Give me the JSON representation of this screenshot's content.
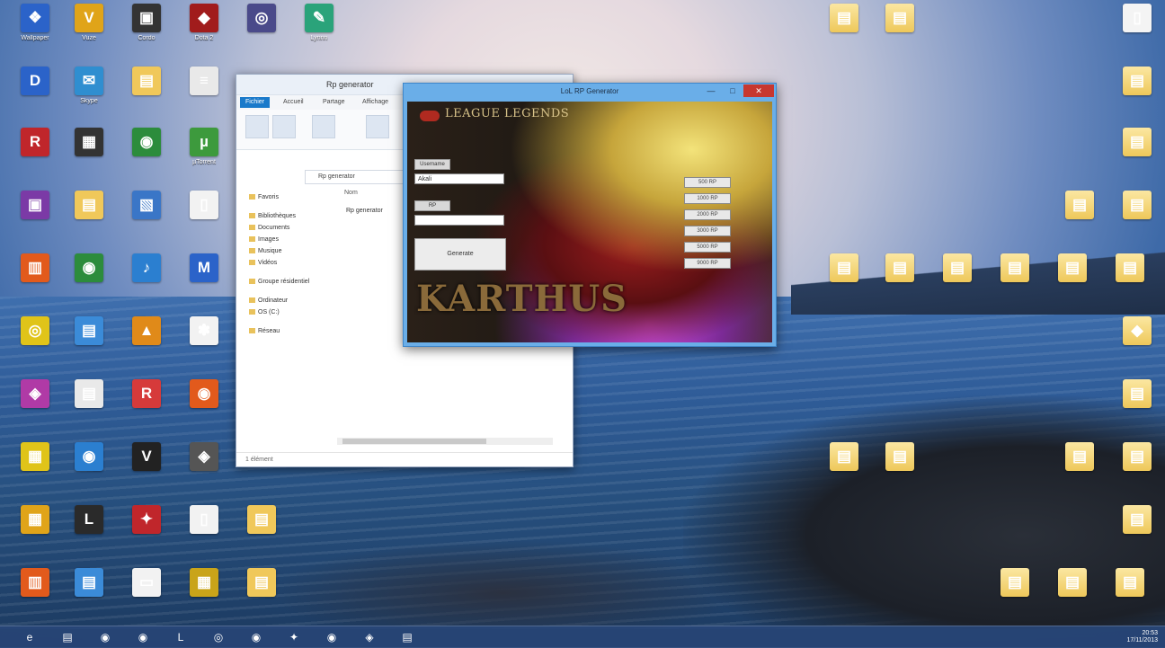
{
  "desktop": {
    "icons_left": [
      {
        "label": "Wallpaper",
        "glyph": "❖",
        "color": "#2b63c9"
      },
      {
        "label": "Vuze",
        "glyph": "V",
        "color": "#e0a419"
      },
      {
        "label": "Cordo",
        "glyph": "▣",
        "color": "#333333"
      },
      {
        "label": "Dota 2",
        "glyph": "◆",
        "color": "#a11c1c"
      },
      {
        "label": "",
        "glyph": "◎",
        "color": "#4a4a8a"
      },
      {
        "label": "Lynnn",
        "glyph": "✎",
        "color": "#2aa37a"
      },
      {
        "label": "",
        "glyph": "D",
        "color": "#2b63c9"
      },
      {
        "label": "Skype",
        "glyph": "✉",
        "color": "#2f8ed0"
      },
      {
        "label": "",
        "glyph": "▤",
        "color": "#f0c85a"
      },
      {
        "label": "",
        "glyph": "≡",
        "color": "#e9e9e9"
      },
      {
        "label": "",
        "glyph": "R",
        "color": "#c0262b"
      },
      {
        "label": "",
        "glyph": "▦",
        "color": "#333333"
      },
      {
        "label": "",
        "glyph": "◉",
        "color": "#2c8c3c"
      },
      {
        "label": "µTorrent",
        "glyph": "µ",
        "color": "#3d9a3d"
      },
      {
        "label": "",
        "glyph": "▣",
        "color": "#7b3aa6"
      },
      {
        "label": "",
        "glyph": "▤",
        "color": "#f0c85a"
      },
      {
        "label": "",
        "glyph": "▧",
        "color": "#3a76c7"
      },
      {
        "label": "",
        "glyph": "▯",
        "color": "#f2f2f2"
      },
      {
        "label": "",
        "glyph": "▥",
        "color": "#e25a1c"
      },
      {
        "label": "",
        "glyph": "◉",
        "color": "#2c8c3c"
      },
      {
        "label": "",
        "glyph": "♪",
        "color": "#2b7fd0"
      },
      {
        "label": "",
        "glyph": "M",
        "color": "#2b63c9"
      },
      {
        "label": "",
        "glyph": "◎",
        "color": "#e0c419"
      },
      {
        "label": "",
        "glyph": "▤",
        "color": "#3b8bd8"
      },
      {
        "label": "",
        "glyph": "▲",
        "color": "#e08a19"
      },
      {
        "label": "",
        "glyph": "✽",
        "color": "#f2f2f2"
      },
      {
        "label": "",
        "glyph": "◈",
        "color": "#b03aa6"
      },
      {
        "label": "",
        "glyph": "▤",
        "color": "#e9e9e9"
      },
      {
        "label": "",
        "glyph": "R",
        "color": "#d63a3a"
      },
      {
        "label": "",
        "glyph": "◉",
        "color": "#e25a1c"
      },
      {
        "label": "",
        "glyph": "▦",
        "color": "#e0c419"
      },
      {
        "label": "",
        "glyph": "◉",
        "color": "#2b7fd0"
      },
      {
        "label": "",
        "glyph": "V",
        "color": "#222222"
      },
      {
        "label": "",
        "glyph": "◈",
        "color": "#555555"
      },
      {
        "label": "",
        "glyph": "▦",
        "color": "#e0a419"
      },
      {
        "label": "",
        "glyph": "L",
        "color": "#2a2a2a"
      },
      {
        "label": "",
        "glyph": "✦",
        "color": "#c0262b"
      },
      {
        "label": "",
        "glyph": "▯",
        "color": "#f2f2f2"
      },
      {
        "label": "",
        "glyph": "▤",
        "color": "#f0c85a"
      },
      {
        "label": "",
        "glyph": "▥",
        "color": "#e25a1c"
      },
      {
        "label": "",
        "glyph": "▤",
        "color": "#3b8bd8"
      },
      {
        "label": "",
        "glyph": "▭",
        "color": "#f2f2f2"
      },
      {
        "label": "",
        "glyph": "▦",
        "color": "#c9a419"
      },
      {
        "label": "",
        "glyph": "▤",
        "color": "#f0c85a"
      }
    ],
    "icons_right": [
      {
        "label": "",
        "glyph": "▤"
      },
      {
        "label": "",
        "glyph": "▤"
      },
      {
        "label": "",
        "glyph": "▯"
      },
      {
        "label": "",
        "glyph": "▤"
      },
      {
        "label": "",
        "glyph": "▤"
      },
      {
        "label": "",
        "glyph": "▤"
      },
      {
        "label": "",
        "glyph": "▤"
      },
      {
        "label": "",
        "glyph": "▤"
      },
      {
        "label": "",
        "glyph": "▤"
      },
      {
        "label": "",
        "glyph": "▤"
      },
      {
        "label": "",
        "glyph": "▤"
      },
      {
        "label": "",
        "glyph": "▤"
      },
      {
        "label": "",
        "glyph": "▤"
      },
      {
        "label": "",
        "glyph": "◆"
      },
      {
        "label": "",
        "glyph": "▤"
      },
      {
        "label": "",
        "glyph": "▤"
      },
      {
        "label": "",
        "glyph": "▤"
      },
      {
        "label": "",
        "glyph": "▤"
      },
      {
        "label": "",
        "glyph": "▤"
      },
      {
        "label": "",
        "glyph": "▤"
      },
      {
        "label": "",
        "glyph": "▤"
      },
      {
        "label": "",
        "glyph": "▤"
      },
      {
        "label": "",
        "glyph": "▤"
      }
    ]
  },
  "explorer": {
    "title": "Rp generator",
    "tabs": [
      "Fichier",
      "Accueil",
      "Partage",
      "Affichage"
    ],
    "address": "Rp generator",
    "column_header": "Nom",
    "file_row": "Rp generator",
    "nav": [
      "Favoris",
      "Bibliothèques",
      "Documents",
      "Images",
      "Musique",
      "Vidéos",
      "Groupe résidentiel",
      "Ordinateur",
      "OS (C:)",
      "Réseau"
    ],
    "status": "1 élément"
  },
  "generator": {
    "title": "LoL RP Generator",
    "logo": "LEAGUE LEGENDS",
    "label_user": "Username",
    "label_rp": "RP",
    "user_value": "Akali",
    "rp_value": "",
    "generate_button": "Generate",
    "small_buttons": [
      "500 RP",
      "1000 RP",
      "2000 RP",
      "3000 RP",
      "5000 RP",
      "9000 RP"
    ],
    "splash_text": "KARTHUS",
    "close_glyph": "✕",
    "min_glyph": "—",
    "max_glyph": "□"
  },
  "taskbar": {
    "apps": [
      "e",
      "▤",
      "◉",
      "◉",
      "L",
      "◎",
      "◉",
      "✦",
      "◉",
      "◈",
      "▤"
    ],
    "time": "20:53",
    "date": "17/11/2013"
  }
}
